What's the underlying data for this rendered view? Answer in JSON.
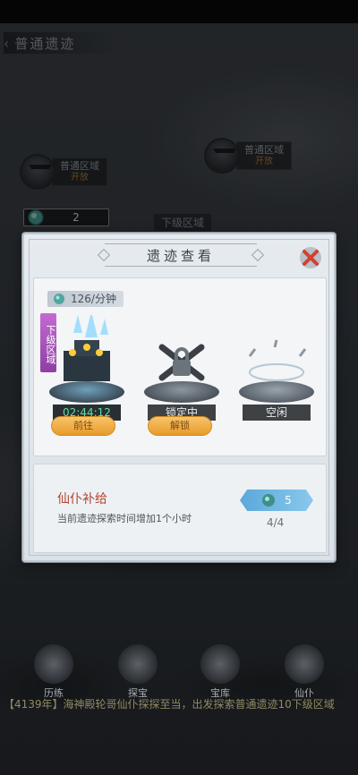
{
  "header": {
    "back_label": "普通遗迹",
    "back_chevron": "‹"
  },
  "map": {
    "nodes": [
      {
        "title": "普通区域",
        "status": "开放"
      },
      {
        "title": "普通区域",
        "status": "开放"
      }
    ],
    "gem_count": "2",
    "lower_region_label": "下级区域"
  },
  "dialog": {
    "title": "遗迹查看",
    "rate_text": "126/分钟",
    "region_badge": "下级区域",
    "slots": [
      {
        "label": "02:44:12",
        "state": "active",
        "button": "前往"
      },
      {
        "label": "锁定中",
        "state": "locked",
        "button": "解锁"
      },
      {
        "label": "空闲",
        "state": "idle"
      }
    ],
    "supply": {
      "title": "仙仆补给",
      "description": "当前遗迹探索时间增加1个小时",
      "cost": "5",
      "count": "4/4"
    }
  },
  "bottom_bar": {
    "items": [
      "历练",
      "探宝",
      "宝库",
      "仙仆"
    ]
  },
  "ticker": "【4139年】海神殿轮哥仙仆探探至当，出发探索普通遗迹10下级区域",
  "colors": {
    "accent_orange": "#e89a2a",
    "timer_green": "#5ee0a2",
    "region_purple": "#8e3fa4",
    "supply_red": "#b0452d"
  }
}
